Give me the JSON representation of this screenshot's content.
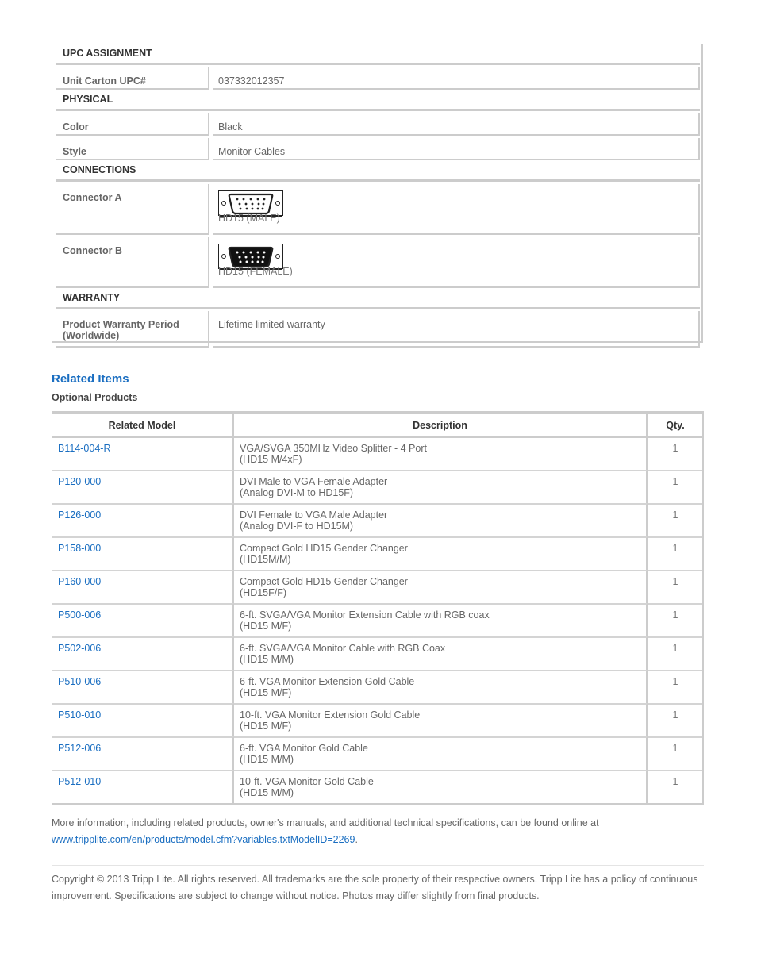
{
  "specs": {
    "sections": [
      {
        "title": "UPC ASSIGNMENT",
        "rows": [
          {
            "label": "Unit Carton UPC#",
            "value": "037332012357"
          }
        ]
      },
      {
        "title": "PHYSICAL",
        "rows": [
          {
            "label": "Color",
            "value": "Black"
          },
          {
            "label": "Style",
            "value": "Monitor Cables"
          }
        ]
      },
      {
        "title": "CONNECTIONS",
        "rows": [
          {
            "label": "Connector A",
            "icon": "hd15-male-connector-icon",
            "value": "HD15 (MALE)"
          },
          {
            "label": "Connector B",
            "icon": "hd15-female-connector-icon",
            "value": "HD15 (FEMALE)"
          }
        ]
      },
      {
        "title": "WARRANTY",
        "rows": [
          {
            "label": "Product Warranty Period (Worldwide)",
            "value": "Lifetime limited warranty"
          }
        ]
      }
    ]
  },
  "related": {
    "title": "Related Items",
    "subtitle": "Optional Products",
    "headers": [
      "Related Model",
      "Description",
      "Qty."
    ],
    "rows": [
      {
        "model": "B114-004-R",
        "desc1": "VGA/SVGA 350MHz Video Splitter - 4 Port",
        "desc2": "(HD15 M/4xF)",
        "qty": "1"
      },
      {
        "model": "P120-000",
        "desc1": "DVI Male to VGA Female Adapter",
        "desc2": "(Analog DVI-M to HD15F)",
        "qty": "1"
      },
      {
        "model": "P126-000",
        "desc1": "DVI Female to VGA Male Adapter",
        "desc2": "(Analog DVI-F to HD15M)",
        "qty": "1"
      },
      {
        "model": "P158-000",
        "desc1": "Compact Gold HD15 Gender Changer",
        "desc2": "(HD15M/M)",
        "qty": "1"
      },
      {
        "model": "P160-000",
        "desc1": "Compact Gold HD15 Gender Changer",
        "desc2": "(HD15F/F)",
        "qty": "1"
      },
      {
        "model": "P500-006",
        "desc1": "6-ft. SVGA/VGA Monitor Extension Cable with RGB coax",
        "desc2": "(HD15 M/F)",
        "qty": "1"
      },
      {
        "model": "P502-006",
        "desc1": "6-ft. SVGA/VGA Monitor Cable with RGB Coax",
        "desc2": "(HD15 M/M)",
        "qty": "1"
      },
      {
        "model": "P510-006",
        "desc1": "6-ft. VGA Monitor Extension Gold Cable",
        "desc2": "(HD15 M/F)",
        "qty": "1"
      },
      {
        "model": "P510-010",
        "desc1": "10-ft. VGA Monitor Extension Gold Cable",
        "desc2": "(HD15 M/F)",
        "qty": "1"
      },
      {
        "model": "P512-006",
        "desc1": "6-ft. VGA Monitor Gold Cable",
        "desc2": "(HD15 M/M)",
        "qty": "1"
      },
      {
        "model": "P512-010",
        "desc1": "10-ft. VGA Monitor Gold Cable",
        "desc2": "(HD15 M/M)",
        "qty": "1"
      }
    ]
  },
  "footer": {
    "more_info_text": "More information, including related products, owner's manuals, and additional technical specifications, can be found online at",
    "more_info_link": "www.tripplite.com/en/products/model.cfm?variables.txtModelID=2269",
    "more_info_end": ".",
    "copyright": "Copyright © 2013 Tripp Lite. All rights reserved. All trademarks are the sole property of their respective owners. Tripp Lite has a policy of continuous improvement. Specifications are subject to change without notice. Photos may differ slightly from final products."
  },
  "colors": {
    "link": "#1a6ec1",
    "border": "#cccccc",
    "text": "#666666"
  }
}
